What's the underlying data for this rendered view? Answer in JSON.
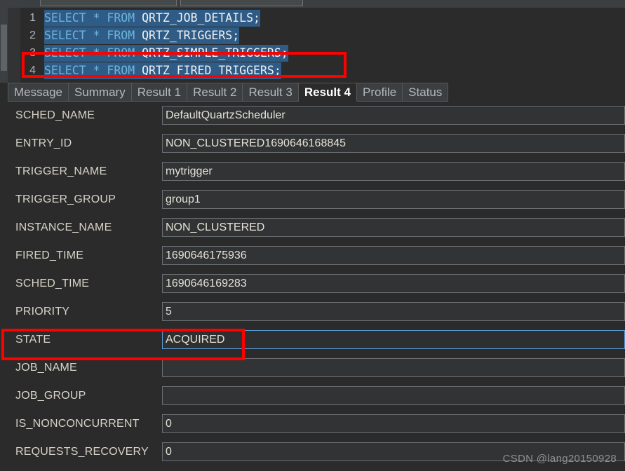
{
  "toolbar": {
    "input_a": "",
    "input_b": ""
  },
  "editor": {
    "lines": [
      {
        "number": "1",
        "keyword": "SELECT * FROM ",
        "identifier": "QRTZ_JOB_DETAILS;"
      },
      {
        "number": "2",
        "keyword": "SELECT * FROM ",
        "identifier": "QRTZ_TRIGGERS;"
      },
      {
        "number": "3",
        "keyword": "SELECT * FROM ",
        "identifier": "QRTZ_SIMPLE_TRIGGERS;"
      },
      {
        "number": "4",
        "keyword": "SELECT * FROM ",
        "identifier": "QRTZ_FIRED_TRIGGERS;"
      }
    ]
  },
  "tabs": [
    {
      "label": "Message",
      "active": false
    },
    {
      "label": "Summary",
      "active": false
    },
    {
      "label": "Result 1",
      "active": false
    },
    {
      "label": "Result 2",
      "active": false
    },
    {
      "label": "Result 3",
      "active": false
    },
    {
      "label": "Result 4",
      "active": true
    },
    {
      "label": "Profile",
      "active": false
    },
    {
      "label": "Status",
      "active": false
    }
  ],
  "fields": [
    {
      "label": "SCHED_NAME",
      "value": "DefaultQuartzScheduler",
      "focused": false
    },
    {
      "label": "ENTRY_ID",
      "value": "NON_CLUSTERED1690646168845",
      "focused": false
    },
    {
      "label": "TRIGGER_NAME",
      "value": "mytrigger",
      "focused": false
    },
    {
      "label": "TRIGGER_GROUP",
      "value": "group1",
      "focused": false
    },
    {
      "label": "INSTANCE_NAME",
      "value": "NON_CLUSTERED",
      "focused": false
    },
    {
      "label": "FIRED_TIME",
      "value": "1690646175936",
      "focused": false
    },
    {
      "label": "SCHED_TIME",
      "value": "1690646169283",
      "focused": false
    },
    {
      "label": "PRIORITY",
      "value": "5",
      "focused": false
    },
    {
      "label": "STATE",
      "value": "ACQUIRED",
      "focused": true
    },
    {
      "label": "JOB_NAME",
      "value": "",
      "focused": false
    },
    {
      "label": "JOB_GROUP",
      "value": "",
      "focused": false
    },
    {
      "label": "IS_NONCONCURRENT",
      "value": "0",
      "focused": false
    },
    {
      "label": "REQUESTS_RECOVERY",
      "value": "0",
      "focused": false
    }
  ],
  "annotations": {
    "sql_highlight_label": "SELECT * FROM QRTZ_FIRED_TRIGGERS;",
    "state_highlight_label": "STATE ACQUIRED",
    "color": "#fe0000"
  },
  "watermark": "CSDN @lang20150928",
  "colors": {
    "background": "#2b2b2b",
    "panel": "#3c3f41",
    "field_bg": "#313335",
    "keyword": "#6fb3dc",
    "selection": "#2f5c86",
    "focus_border": "#5b9bd5",
    "annotation": "#fe0000"
  }
}
